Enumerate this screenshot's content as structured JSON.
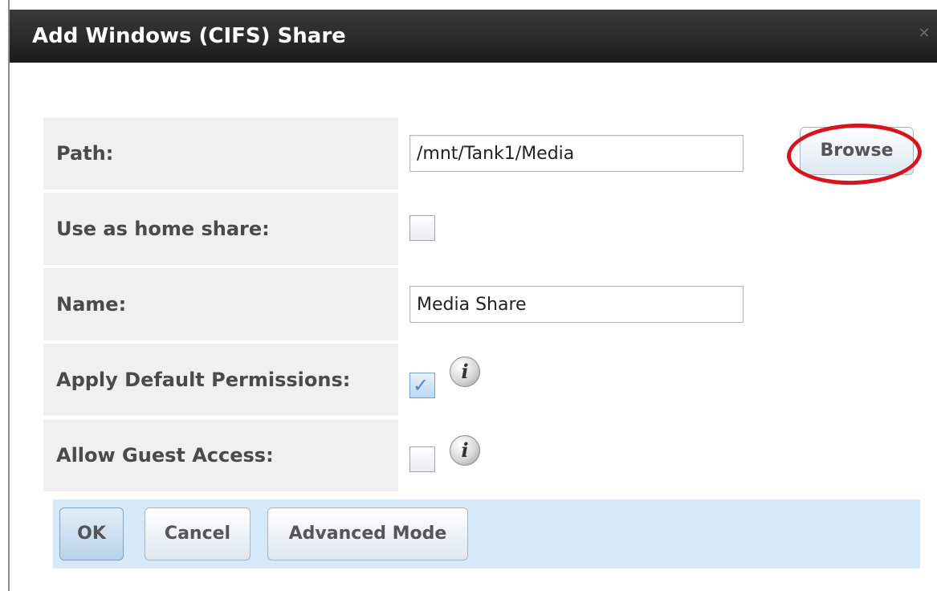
{
  "dialog": {
    "title": "Add Windows (CIFS) Share"
  },
  "form": {
    "path": {
      "label": "Path:",
      "value": "/mnt/Tank1/Media",
      "browse_label": "Browse"
    },
    "home_share": {
      "label": "Use as home share:",
      "checked": false
    },
    "name": {
      "label": "Name:",
      "value": "Media Share"
    },
    "default_permissions": {
      "label": "Apply Default Permissions:",
      "checked": true
    },
    "guest_access": {
      "label": "Allow Guest Access:",
      "checked": false
    }
  },
  "buttons": {
    "ok_label": "OK",
    "cancel_label": "Cancel",
    "advanced_label": "Advanced Mode"
  },
  "icons": {
    "info_glyph": "i",
    "close_glyph": "✕",
    "check_glyph": "✓"
  },
  "colors": {
    "titlebar": "#1c1c1c",
    "button_bar": "#d6e9f8",
    "highlight": "#d7141d"
  }
}
